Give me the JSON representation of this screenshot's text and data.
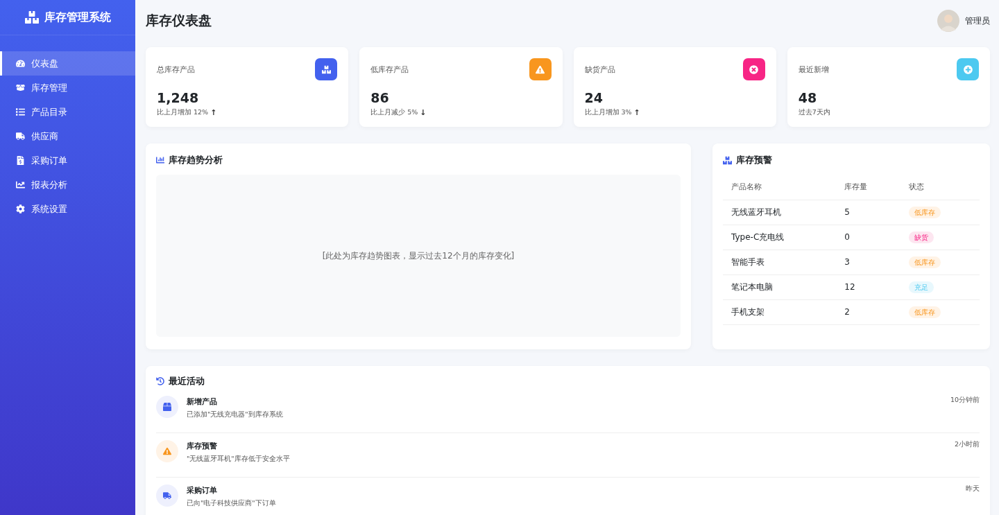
{
  "sidebar": {
    "title": "库存管理系统",
    "items": [
      {
        "label": "仪表盘",
        "selected": true
      },
      {
        "label": "库存管理",
        "selected": false
      },
      {
        "label": "产品目录",
        "selected": false
      },
      {
        "label": "供应商",
        "selected": false
      },
      {
        "label": "采购订单",
        "selected": false
      },
      {
        "label": "报表分析",
        "selected": false
      },
      {
        "label": "系统设置",
        "selected": false
      }
    ]
  },
  "header": {
    "title": "库存仪表盘",
    "user": "管理员"
  },
  "stats": [
    {
      "label": "总库存产品",
      "value": "1,248",
      "note": "比上月增加 12%",
      "arrow": "↑",
      "color": "#4361ee",
      "kind": "boxes"
    },
    {
      "label": "低库存产品",
      "value": "86",
      "note": "比上月减少 5%",
      "arrow": "↓",
      "color": "#f8961e",
      "kind": "warning"
    },
    {
      "label": "缺货产品",
      "value": "24",
      "note": "比上月增加 3%",
      "arrow": "↑",
      "color": "#f72585",
      "kind": "cross"
    },
    {
      "label": "最近新增",
      "value": "48",
      "note": "过去7天内",
      "color": "#4cc9f0",
      "kind": "plus"
    }
  ],
  "trend_card": {
    "title": "库存趋势分析",
    "placeholder": "[此处为库存趋势图表，显示过去12个月的库存变化]"
  },
  "alert_card": {
    "title": "库存预警",
    "columns": [
      "产品名称",
      "库存量",
      "状态"
    ],
    "rows": [
      {
        "name": "无线蓝牙耳机",
        "qty": "5",
        "status": "低库存",
        "kind": "low"
      },
      {
        "name": "Type-C充电线",
        "qty": "0",
        "status": "缺货",
        "kind": "out"
      },
      {
        "name": "智能手表",
        "qty": "3",
        "status": "低库存",
        "kind": "low"
      },
      {
        "name": "笔记本电脑",
        "qty": "12",
        "status": "充足",
        "kind": "ok"
      },
      {
        "name": "手机支架",
        "qty": "2",
        "status": "低库存",
        "kind": "low"
      }
    ]
  },
  "activity": {
    "title": "最近活动",
    "items": [
      {
        "kind": "product",
        "title": "新增产品",
        "text": "已添加\"无线充电器\"到库存系统",
        "time": "10分钟前"
      },
      {
        "kind": "warning",
        "title": "库存预警",
        "text": "\"无线蓝牙耳机\"库存低于安全水平",
        "time": "2小时前"
      },
      {
        "kind": "order",
        "title": "采购订单",
        "text": "已向\"电子科技供应商\"下订单",
        "time": "昨天"
      }
    ]
  }
}
